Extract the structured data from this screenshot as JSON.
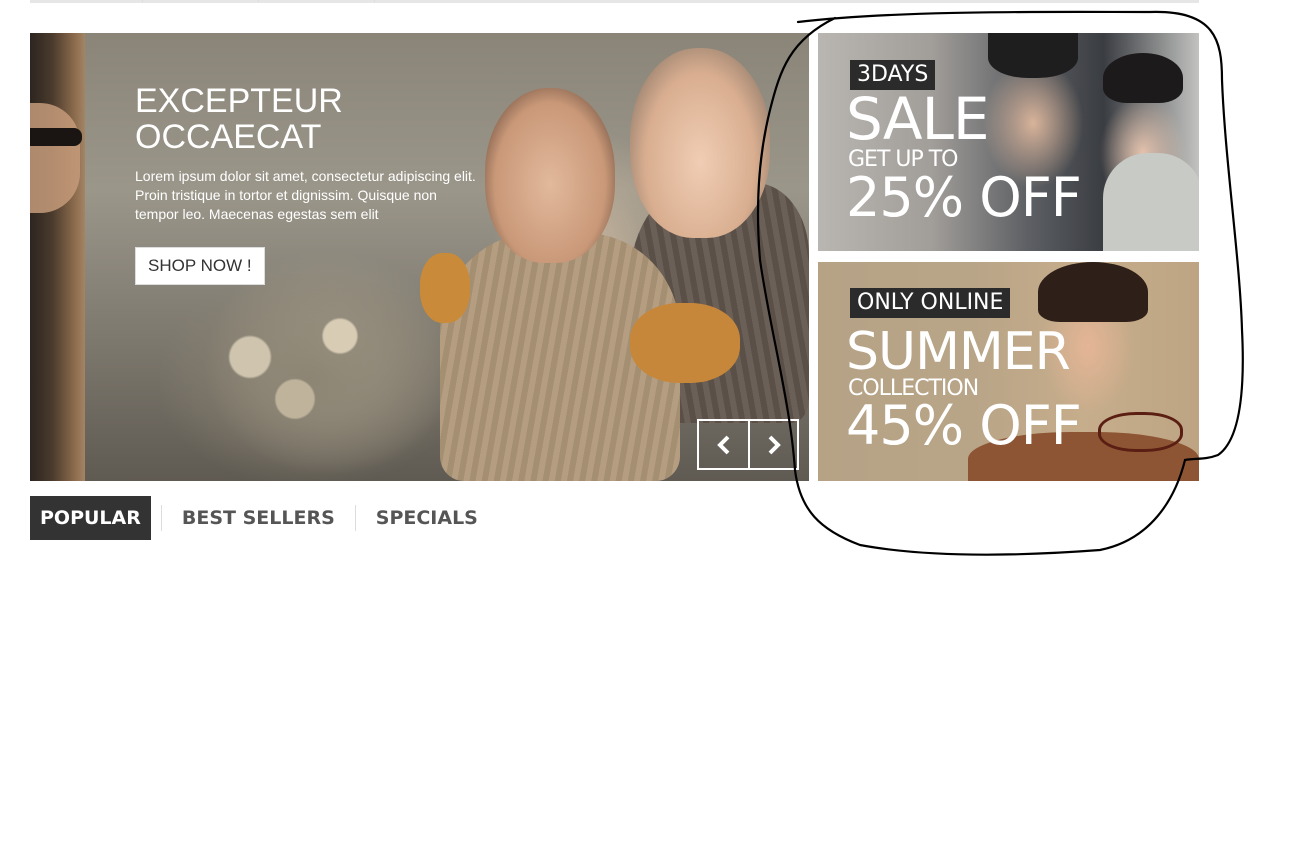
{
  "slider": {
    "title_line1": "EXCEPTEUR",
    "title_line2": "OCCAECAT",
    "text": "Lorem ipsum dolor sit amet, consectetur adipiscing elit. Proin tristique in tortor et dignissim. Quisque non tempor leo. Maecenas egestas sem elit",
    "button_label": "SHOP NOW !",
    "prev_icon": "chevron-left",
    "next_icon": "chevron-right"
  },
  "banners": [
    {
      "tag": "3DAYS",
      "headline": "SALE",
      "subline": "GET UP TO",
      "offer": "25% OFF"
    },
    {
      "tag": "ONLY ONLINE",
      "headline": "SUMMER",
      "subline": "COLLECTION",
      "offer": "45% OFF"
    }
  ],
  "tabs": [
    {
      "label": "POPULAR",
      "active": true
    },
    {
      "label": "BEST SELLERS",
      "active": false
    },
    {
      "label": "SPECIALS",
      "active": false
    }
  ],
  "colors": {
    "tab_active_bg": "#333333",
    "tag_bg": "#2b2b2b",
    "text_white": "#ffffff"
  }
}
